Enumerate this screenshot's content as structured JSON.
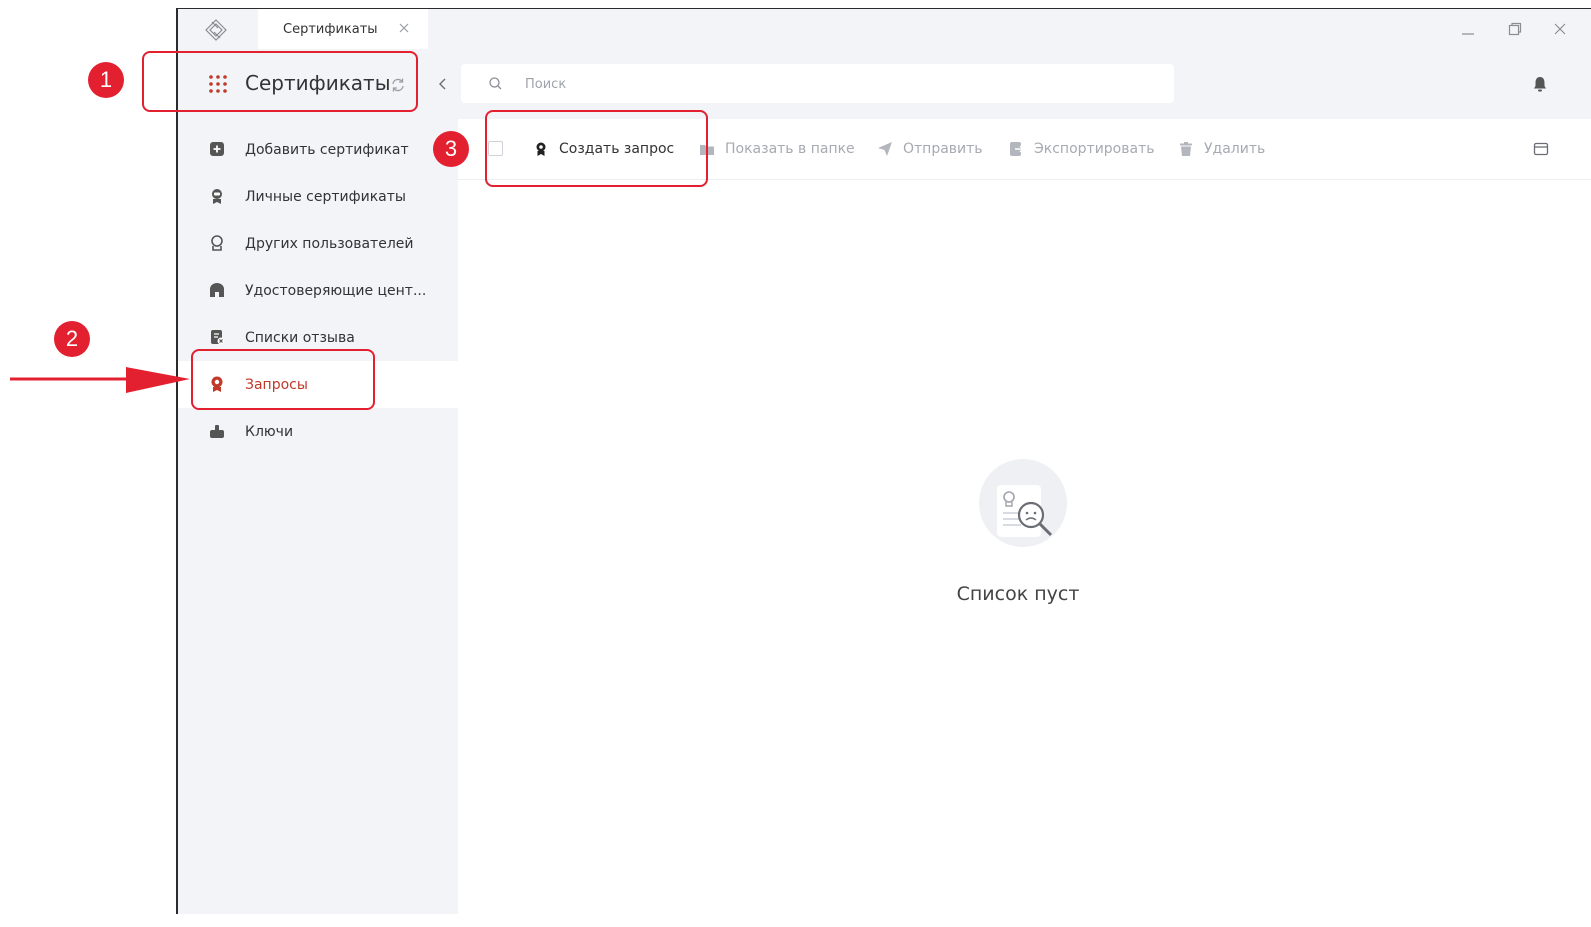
{
  "titlebar": {
    "tab_label": "Сертификаты"
  },
  "sidebar": {
    "title": "Сертификаты",
    "items": [
      {
        "label": "Добавить сертификат",
        "icon": "plus-square-icon"
      },
      {
        "label": "Личные сертификаты",
        "icon": "certificate-badge-icon"
      },
      {
        "label": "Других пользователей",
        "icon": "award-outline-icon"
      },
      {
        "label": "Удостоверяющие цент...",
        "icon": "building-icon"
      },
      {
        "label": "Списки отзыва",
        "icon": "revocation-list-icon"
      },
      {
        "label": "Запросы",
        "icon": "request-badge-icon",
        "active": true
      },
      {
        "label": "Ключи",
        "icon": "key-token-icon"
      }
    ]
  },
  "search": {
    "placeholder": "Поиск",
    "value": ""
  },
  "toolbar": {
    "create_request": "Создать запрос",
    "show_in_folder": "Показать в папке",
    "send": "Отправить",
    "export": "Экспортировать",
    "delete": "Удалить"
  },
  "empty_state": {
    "text": "Список пуст"
  },
  "annotations": {
    "n1": "1",
    "n2": "2",
    "n3": "3"
  },
  "colors": {
    "accent": "#c0392b",
    "annotation": "#e3202f",
    "sidebar_bg": "#f3f4f8"
  }
}
